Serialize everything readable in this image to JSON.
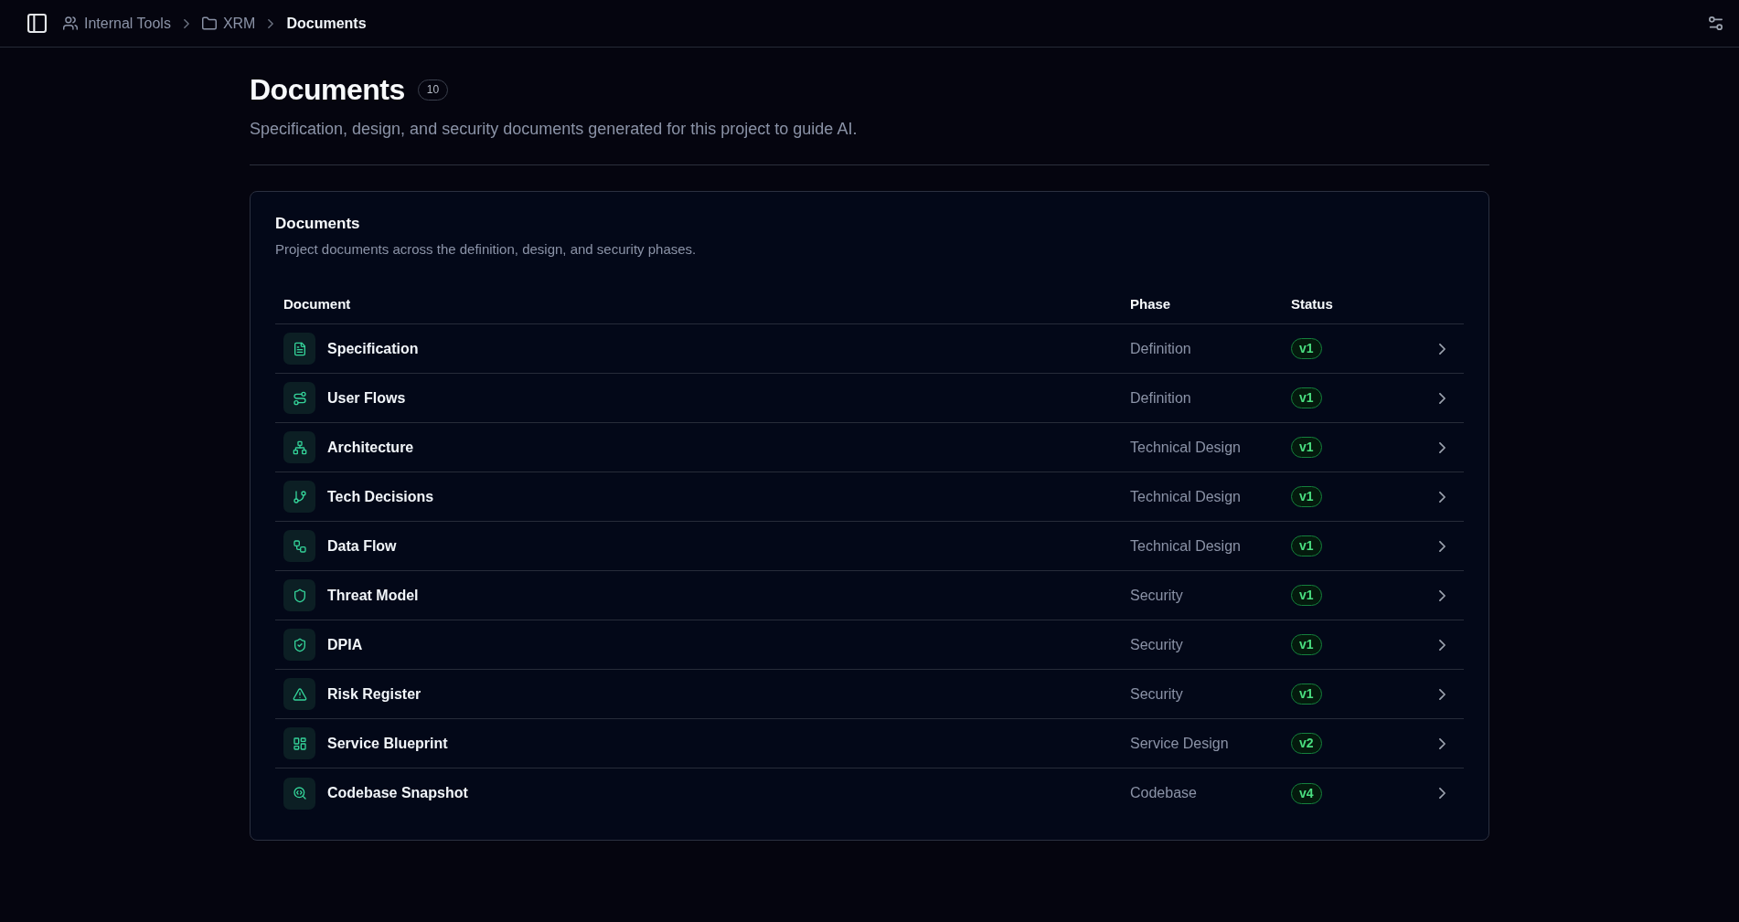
{
  "topbar": {
    "breadcrumb": [
      {
        "label": "Internal Tools",
        "current": false
      },
      {
        "label": "XRM",
        "current": false
      },
      {
        "label": "Documents",
        "current": true
      }
    ]
  },
  "header": {
    "title": "Documents",
    "count": "10",
    "subtitle": "Specification, design, and security documents generated for this project to guide AI."
  },
  "documents_card": {
    "title": "Documents",
    "description": "Project documents across the definition, design, and security phases.",
    "table": {
      "columns": [
        "Document",
        "Phase",
        "Status"
      ],
      "rows": [
        {
          "document": "Specification",
          "phase": "Definition",
          "status": "v1"
        },
        {
          "document": "User Flows",
          "phase": "Definition",
          "status": "v1"
        },
        {
          "document": "Architecture",
          "phase": "Technical Design",
          "status": "v1"
        },
        {
          "document": "Tech Decisions",
          "phase": "Technical Design",
          "status": "v1"
        },
        {
          "document": "Data Flow",
          "phase": "Technical Design",
          "status": "v1"
        },
        {
          "document": "Threat Model",
          "phase": "Security",
          "status": "v1"
        },
        {
          "document": "DPIA",
          "phase": "Security",
          "status": "v1"
        },
        {
          "document": "Risk Register",
          "phase": "Security",
          "status": "v1"
        },
        {
          "document": "Service Blueprint",
          "phase": "Service Design",
          "status": "v2"
        },
        {
          "document": "Codebase Snapshot",
          "phase": "Codebase",
          "status": "v4"
        }
      ]
    }
  }
}
